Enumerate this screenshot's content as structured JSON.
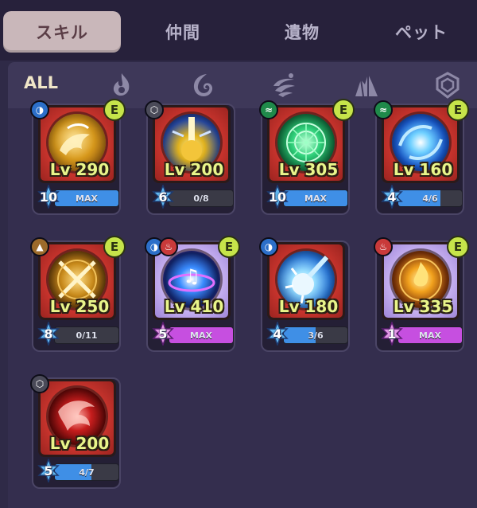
{
  "tabs": [
    {
      "label": "スキル",
      "active": true
    },
    {
      "label": "仲間",
      "active": false
    },
    {
      "label": "遺物",
      "active": false
    },
    {
      "label": "ペット",
      "active": false
    }
  ],
  "filters": {
    "all_label": "ALL",
    "icons": [
      "fire-element-icon",
      "water-element-icon",
      "wind-element-icon",
      "earth-element-icon",
      "shield-element-icon"
    ]
  },
  "colors": {
    "accent_max": "#3f8fe6",
    "legend_max": "#c64fe0",
    "progress": "#3f8fe6",
    "equipped": "#c6e44a",
    "level_text": "#e9f58a"
  },
  "skills": [
    {
      "name": "golden-phoenix-skill",
      "level": "Lv 290",
      "stars": "10",
      "progress_label": "MAX",
      "progress": 1.0,
      "rarity": "epic",
      "element": "water",
      "equipped": true
    },
    {
      "name": "holy-pillar-skill",
      "level": "Lv 200",
      "stars": "6",
      "progress_label": "0/8",
      "progress": 0.0,
      "rarity": "epic",
      "element": "shield",
      "equipped": false
    },
    {
      "name": "green-mandala-skill",
      "level": "Lv 305",
      "stars": "10",
      "progress_label": "MAX",
      "progress": 1.0,
      "rarity": "epic",
      "element": "wind",
      "equipped": true
    },
    {
      "name": "blue-storm-skill",
      "level": "Lv 160",
      "stars": "4",
      "progress_label": "4/6",
      "progress": 0.667,
      "rarity": "epic",
      "element": "wind",
      "equipped": true
    },
    {
      "name": "crossed-swords-skill",
      "level": "Lv 250",
      "stars": "8",
      "progress_label": "0/11",
      "progress": 0.0,
      "rarity": "epic",
      "element": "earth",
      "equipped": true
    },
    {
      "name": "music-sphere-skill",
      "level": "Lv 410",
      "stars": "5",
      "progress_label": "MAX",
      "progress": 1.0,
      "rarity": "legend",
      "element": "water-fire",
      "equipped": true
    },
    {
      "name": "ice-comet-skill",
      "level": "Lv 180",
      "stars": "4",
      "progress_label": "3/6",
      "progress": 0.5,
      "rarity": "epic",
      "element": "water",
      "equipped": false
    },
    {
      "name": "flame-circle-skill",
      "level": "Lv 335",
      "stars": "1",
      "progress_label": "MAX",
      "progress": 1.0,
      "rarity": "legend",
      "element": "fire",
      "equipped": true
    },
    {
      "name": "crimson-beast-skill",
      "level": "Lv 200",
      "stars": "5",
      "progress_label": "4/7",
      "progress": 0.571,
      "rarity": "epic",
      "element": "shield",
      "equipped": false
    }
  ],
  "equipped_badge_label": "E"
}
